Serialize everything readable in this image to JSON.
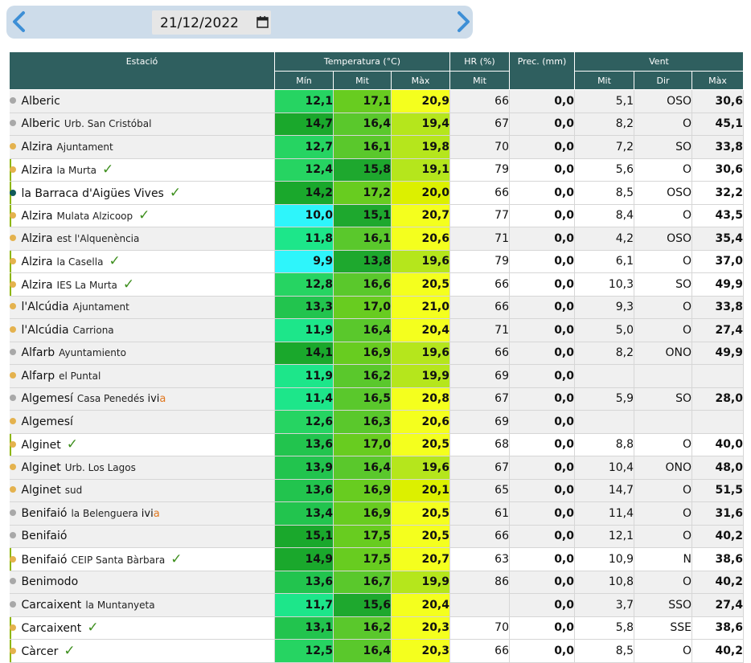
{
  "date_nav": {
    "date_value": "21/12/2022",
    "prev_icon": "chevron-left-icon",
    "next_icon": "chevron-right-icon",
    "calendar_icon": "calendar-icon"
  },
  "headers": {
    "station": "Estació",
    "temperature": "Temperatura (°C)",
    "humidity": "HR (%)",
    "precip": "Prec. (mm)",
    "wind": "Vent",
    "t_min": "Mín",
    "t_mid": "Mit",
    "t_max": "Màx",
    "hr_mid": "Mit",
    "w_mid": "Mit",
    "w_dir": "Dir",
    "w_max": "Màx"
  },
  "colors": {
    "header_bg": "#2f5f5f",
    "row_bg": "#f0f0f0",
    "highlight_border": "#8db600",
    "check": "#3e8f1e",
    "dot_gray": "#a8a8a8",
    "dot_yellow": "#e4b24e",
    "dot_teal": "#115a5a",
    "ivia_orange": "#e07820"
  },
  "rows": [
    {
      "name": "Alberic",
      "sub": "",
      "dot": "gray",
      "check": false,
      "ivia": false,
      "tmin": "12,1",
      "tmid": "17,1",
      "tmax": "20,9",
      "hr": "66",
      "prec": "0,0",
      "wmid": "5,1",
      "wdir": "OSO",
      "wmax": "30,6"
    },
    {
      "name": "Alberic",
      "sub": "Urb. San Cristóbal",
      "dot": "gray",
      "check": false,
      "ivia": false,
      "tmin": "14,7",
      "tmid": "16,4",
      "tmax": "19,4",
      "hr": "67",
      "prec": "0,0",
      "wmid": "8,2",
      "wdir": "O",
      "wmax": "45,1"
    },
    {
      "name": "Alzira",
      "sub": "Ajuntament",
      "dot": "yellow",
      "check": false,
      "ivia": false,
      "tmin": "12,7",
      "tmid": "16,1",
      "tmax": "19,8",
      "hr": "70",
      "prec": "0,0",
      "wmid": "7,2",
      "wdir": "SO",
      "wmax": "33,8"
    },
    {
      "name": "Alzira",
      "sub": "la Murta",
      "dot": "yellow",
      "check": true,
      "ivia": false,
      "tmin": "12,4",
      "tmid": "15,8",
      "tmax": "19,1",
      "hr": "79",
      "prec": "0,0",
      "wmid": "5,6",
      "wdir": "O",
      "wmax": "30,6"
    },
    {
      "name": "la Barraca d'Aigües Vives",
      "sub": "",
      "dot": "teal",
      "check": true,
      "ivia": false,
      "tmin": "14,2",
      "tmid": "17,2",
      "tmax": "20,0",
      "hr": "66",
      "prec": "0,0",
      "wmid": "8,5",
      "wdir": "OSO",
      "wmax": "32,2"
    },
    {
      "name": "Alzira",
      "sub": "Mulata Alzicoop",
      "dot": "yellow",
      "check": true,
      "ivia": false,
      "tmin": "10,0",
      "tmid": "15,1",
      "tmax": "20,7",
      "hr": "77",
      "prec": "0,0",
      "wmid": "8,4",
      "wdir": "O",
      "wmax": "43,5"
    },
    {
      "name": "Alzira",
      "sub": "est l'Alquenència",
      "dot": "yellow",
      "check": false,
      "ivia": false,
      "tmin": "11,8",
      "tmid": "16,1",
      "tmax": "20,6",
      "hr": "71",
      "prec": "0,0",
      "wmid": "4,2",
      "wdir": "OSO",
      "wmax": "35,4"
    },
    {
      "name": "Alzira",
      "sub": "la Casella",
      "dot": "yellow",
      "check": true,
      "ivia": false,
      "tmin": "9,9",
      "tmid": "13,8",
      "tmax": "19,6",
      "hr": "79",
      "prec": "0,0",
      "wmid": "6,1",
      "wdir": "O",
      "wmax": "37,0"
    },
    {
      "name": "Alzira",
      "sub": "IES La Murta",
      "dot": "yellow",
      "check": true,
      "ivia": false,
      "tmin": "12,8",
      "tmid": "16,6",
      "tmax": "20,5",
      "hr": "66",
      "prec": "0,0",
      "wmid": "10,3",
      "wdir": "SO",
      "wmax": "49,9"
    },
    {
      "name": "l'Alcúdia",
      "sub": "Ajuntament",
      "dot": "yellow",
      "check": false,
      "ivia": false,
      "tmin": "13,3",
      "tmid": "17,0",
      "tmax": "21,0",
      "hr": "66",
      "prec": "0,0",
      "wmid": "9,3",
      "wdir": "O",
      "wmax": "33,8"
    },
    {
      "name": "l'Alcúdia",
      "sub": "Carriona",
      "dot": "yellow",
      "check": false,
      "ivia": false,
      "tmin": "11,9",
      "tmid": "16,4",
      "tmax": "20,4",
      "hr": "71",
      "prec": "0,0",
      "wmid": "5,0",
      "wdir": "O",
      "wmax": "27,4"
    },
    {
      "name": "Alfarb",
      "sub": "Ayuntamiento",
      "dot": "gray",
      "check": false,
      "ivia": false,
      "tmin": "14,1",
      "tmid": "16,9",
      "tmax": "19,6",
      "hr": "66",
      "prec": "0,0",
      "wmid": "8,2",
      "wdir": "ONO",
      "wmax": "49,9"
    },
    {
      "name": "Alfarp",
      "sub": "el Puntal",
      "dot": "yellow",
      "check": false,
      "ivia": false,
      "tmin": "11,9",
      "tmid": "16,2",
      "tmax": "19,9",
      "hr": "69",
      "prec": "0,0",
      "wmid": "",
      "wdir": "",
      "wmax": ""
    },
    {
      "name": "Algemesí",
      "sub": "Casa Penedés",
      "dot": "gray",
      "check": false,
      "ivia": true,
      "tmin": "11,4",
      "tmid": "16,5",
      "tmax": "20,8",
      "hr": "67",
      "prec": "0,0",
      "wmid": "5,9",
      "wdir": "SO",
      "wmax": "28,0"
    },
    {
      "name": "Algemesí",
      "sub": "",
      "dot": "yellow",
      "check": false,
      "ivia": false,
      "tmin": "12,6",
      "tmid": "16,3",
      "tmax": "20,6",
      "hr": "69",
      "prec": "0,0",
      "wmid": "",
      "wdir": "",
      "wmax": ""
    },
    {
      "name": "Alginet",
      "sub": "",
      "dot": "yellow",
      "check": true,
      "ivia": false,
      "tmin": "13,6",
      "tmid": "17,0",
      "tmax": "20,5",
      "hr": "68",
      "prec": "0,0",
      "wmid": "8,8",
      "wdir": "O",
      "wmax": "40,0"
    },
    {
      "name": "Alginet",
      "sub": "Urb. Los Lagos",
      "dot": "yellow",
      "check": false,
      "ivia": false,
      "tmin": "13,9",
      "tmid": "16,4",
      "tmax": "19,6",
      "hr": "67",
      "prec": "0,0",
      "wmid": "10,4",
      "wdir": "ONO",
      "wmax": "48,0"
    },
    {
      "name": "Alginet",
      "sub": "sud",
      "dot": "yellow",
      "check": false,
      "ivia": false,
      "tmin": "13,6",
      "tmid": "16,9",
      "tmax": "20,1",
      "hr": "65",
      "prec": "0,0",
      "wmid": "14,7",
      "wdir": "O",
      "wmax": "51,5"
    },
    {
      "name": "Benifaió",
      "sub": "la Belenguera",
      "dot": "gray",
      "check": false,
      "ivia": true,
      "tmin": "13,4",
      "tmid": "16,9",
      "tmax": "20,5",
      "hr": "61",
      "prec": "0,0",
      "wmid": "11,4",
      "wdir": "O",
      "wmax": "31,6"
    },
    {
      "name": "Benifaió",
      "sub": "",
      "dot": "gray",
      "check": false,
      "ivia": false,
      "tmin": "15,1",
      "tmid": "17,5",
      "tmax": "20,5",
      "hr": "66",
      "prec": "0,0",
      "wmid": "12,1",
      "wdir": "O",
      "wmax": "40,2"
    },
    {
      "name": "Benifaió",
      "sub": "CEIP Santa Bàrbara",
      "dot": "yellow",
      "check": true,
      "ivia": false,
      "tmin": "14,9",
      "tmid": "17,5",
      "tmax": "20,7",
      "hr": "63",
      "prec": "0,0",
      "wmid": "10,9",
      "wdir": "N",
      "wmax": "38,6"
    },
    {
      "name": "Benimodo",
      "sub": "",
      "dot": "gray",
      "check": false,
      "ivia": false,
      "tmin": "13,6",
      "tmid": "16,7",
      "tmax": "19,9",
      "hr": "86",
      "prec": "0,0",
      "wmid": "10,8",
      "wdir": "O",
      "wmax": "40,2"
    },
    {
      "name": "Carcaixent",
      "sub": "la Muntanyeta",
      "dot": "gray",
      "check": false,
      "ivia": false,
      "tmin": "11,7",
      "tmid": "15,6",
      "tmax": "20,4",
      "hr": "",
      "prec": "0,0",
      "wmid": "3,7",
      "wdir": "SSO",
      "wmax": "27,4"
    },
    {
      "name": "Carcaixent",
      "sub": "",
      "dot": "yellow",
      "check": true,
      "ivia": false,
      "tmin": "13,1",
      "tmid": "16,2",
      "tmax": "20,3",
      "hr": "70",
      "prec": "0,0",
      "wmid": "5,8",
      "wdir": "SSE",
      "wmax": "38,6"
    },
    {
      "name": "Càrcer",
      "sub": "",
      "dot": "yellow",
      "check": true,
      "ivia": false,
      "tmin": "12,5",
      "tmid": "16,4",
      "tmax": "20,3",
      "hr": "66",
      "prec": "0,0",
      "wmid": "8,5",
      "wdir": "O",
      "wmax": "40,2"
    }
  ]
}
